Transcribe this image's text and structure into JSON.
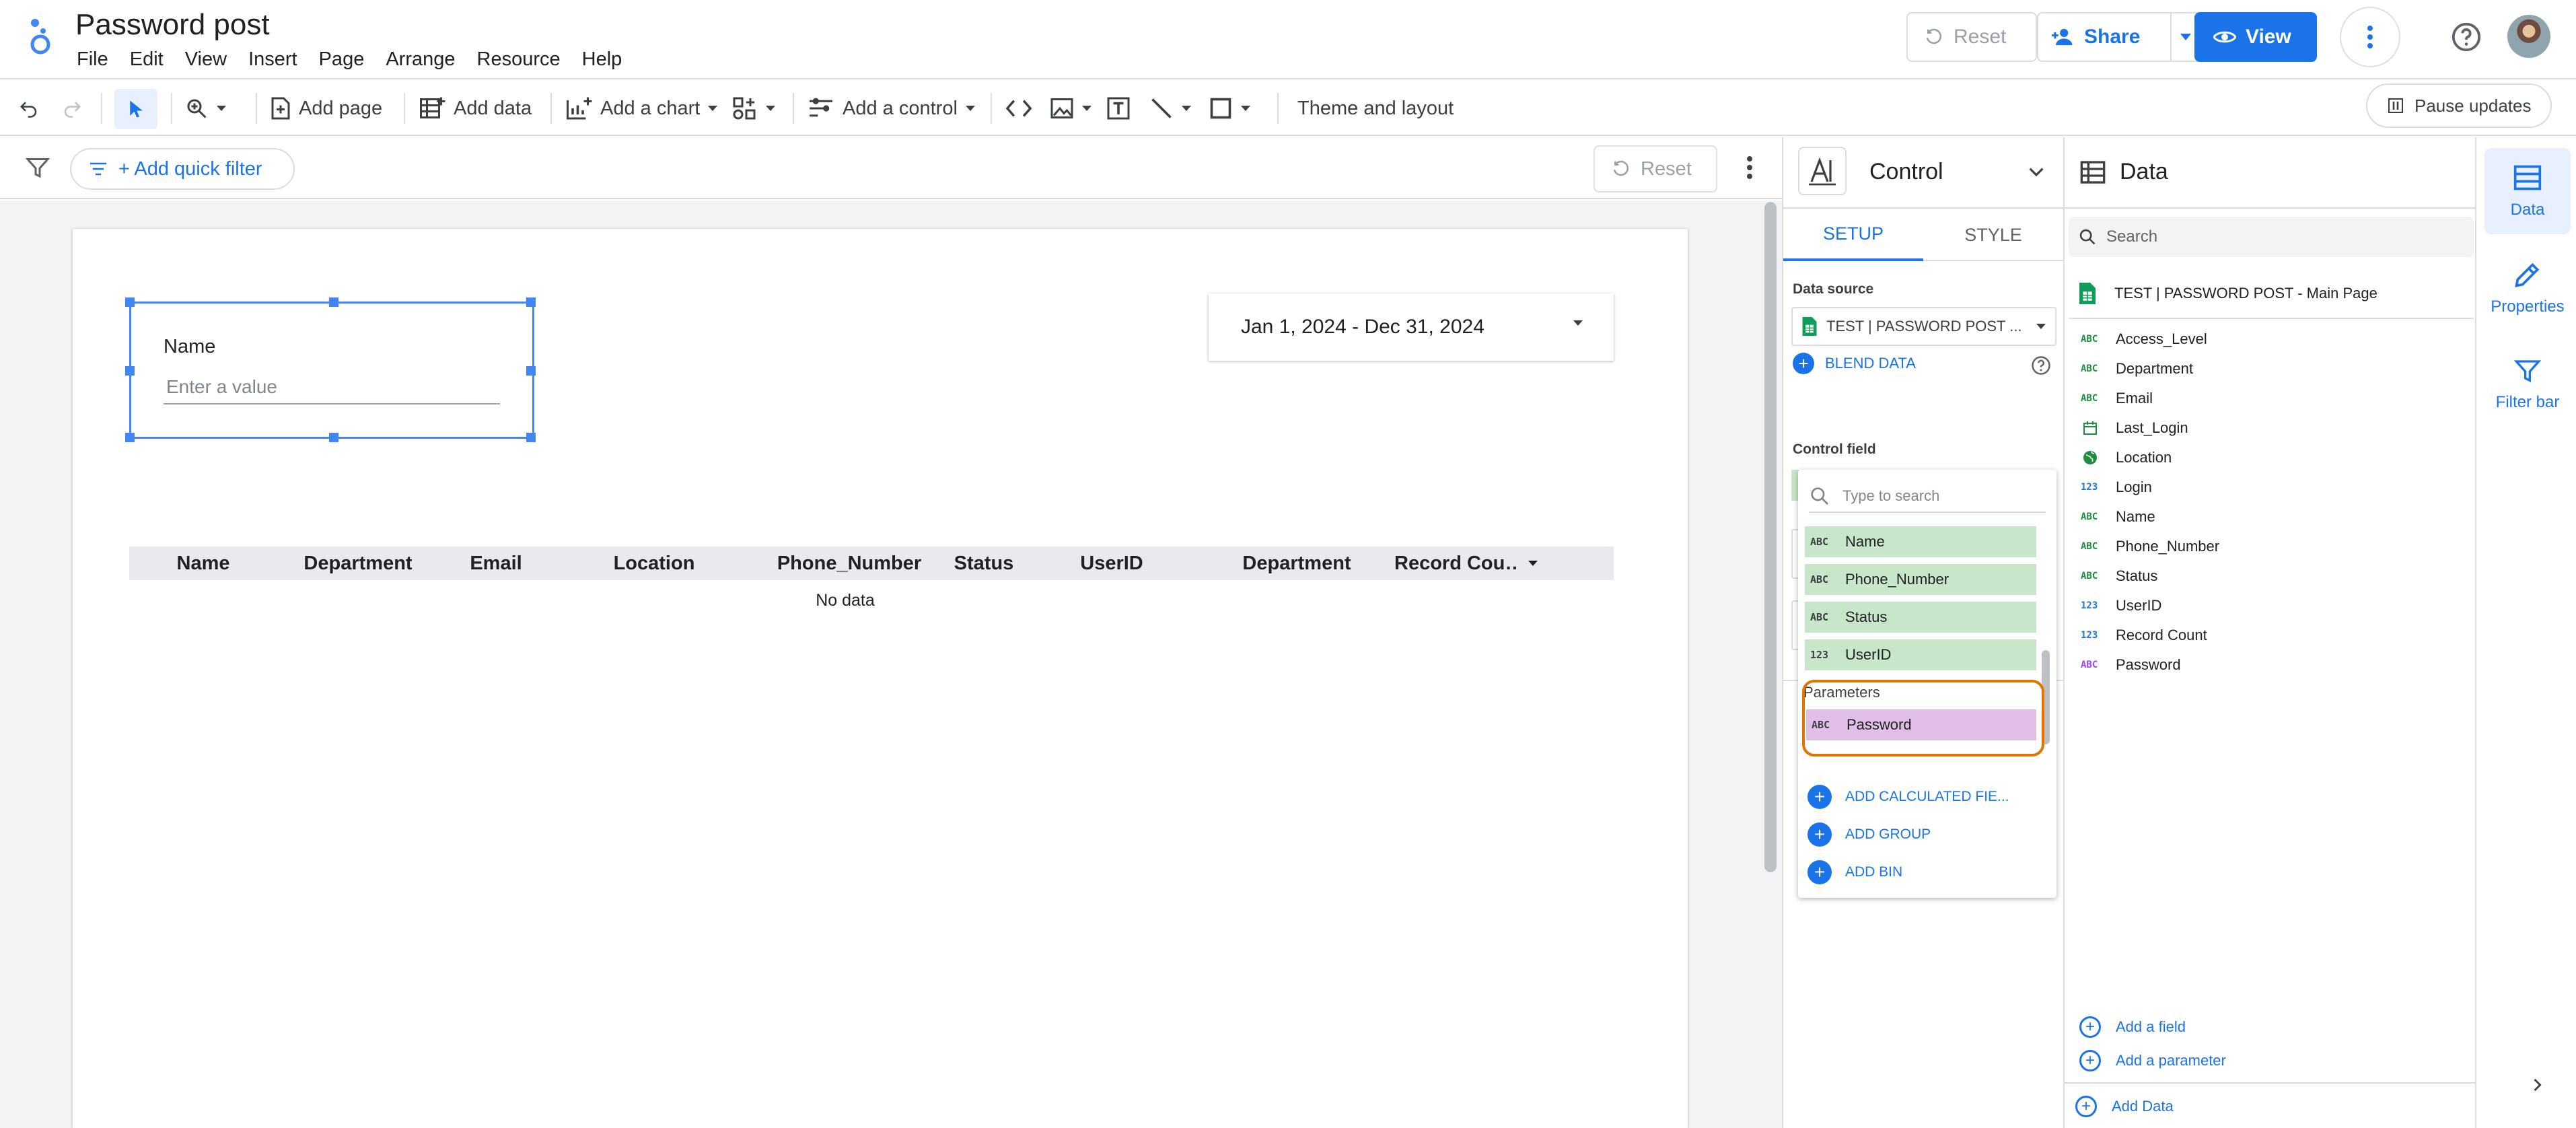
{
  "header": {
    "title": "Password post",
    "menus": [
      "File",
      "Edit",
      "View",
      "Insert",
      "Page",
      "Arrange",
      "Resource",
      "Help"
    ],
    "reset_label": "Reset",
    "share_label": "Share",
    "view_label": "View"
  },
  "toolbar": {
    "add_page": "Add page",
    "add_data": "Add data",
    "add_chart": "Add a chart",
    "add_control": "Add a control",
    "theme": "Theme and layout",
    "pause": "Pause updates"
  },
  "filter_bar": {
    "quick_filter": "+ Add quick filter",
    "reset_label": "Reset"
  },
  "canvas": {
    "name_control": {
      "label": "Name",
      "placeholder": "Enter a value"
    },
    "date_range": "Jan 1, 2024 - Dec 31, 2024",
    "table": {
      "columns": [
        "Name",
        "Department",
        "Email",
        "Location",
        "Phone_Number",
        "Status",
        "UserID",
        "Department",
        "Record Cou…"
      ],
      "empty_text": "No data"
    }
  },
  "properties": {
    "title": "Control",
    "tabs": [
      "SETUP",
      "STYLE"
    ],
    "data_source_label": "Data source",
    "data_source_value": "TEST | PASSWORD POST ...",
    "blend_label": "BLEND DATA",
    "control_field_label": "Control field"
  },
  "field_dropdown": {
    "search_placeholder": "Type to search",
    "fields": [
      {
        "type": "ABC",
        "name": "Name"
      },
      {
        "type": "ABC",
        "name": "Phone_Number"
      },
      {
        "type": "ABC",
        "name": "Status"
      },
      {
        "type": "123",
        "name": "UserID"
      }
    ],
    "parameters_label": "Parameters",
    "parameters": [
      {
        "type": "ABC",
        "name": "Password"
      }
    ],
    "actions": [
      "ADD CALCULATED FIE...",
      "ADD GROUP",
      "ADD BIN"
    ]
  },
  "data_panel": {
    "title": "Data",
    "search_placeholder": "Search",
    "source_name": "TEST | PASSWORD POST - Main Page",
    "fields": [
      {
        "type": "ABC",
        "name": "Access_Level",
        "icon": "text"
      },
      {
        "type": "ABC",
        "name": "Department",
        "icon": "text"
      },
      {
        "type": "ABC",
        "name": "Email",
        "icon": "text"
      },
      {
        "type": "DATE",
        "name": "Last_Login",
        "icon": "calendar"
      },
      {
        "type": "GEO",
        "name": "Location",
        "icon": "globe"
      },
      {
        "type": "123",
        "name": "Login",
        "icon": "number"
      },
      {
        "type": "ABC",
        "name": "Name",
        "icon": "text"
      },
      {
        "type": "ABC",
        "name": "Phone_Number",
        "icon": "text"
      },
      {
        "type": "ABC",
        "name": "Status",
        "icon": "text"
      },
      {
        "type": "123",
        "name": "UserID",
        "icon": "number"
      },
      {
        "type": "123",
        "name": "Record Count",
        "icon": "number"
      },
      {
        "type": "ABC",
        "name": "Password",
        "icon": "parameter"
      }
    ],
    "add_field": "Add a field",
    "add_parameter": "Add a parameter",
    "add_data": "Add Data"
  },
  "rail": {
    "items": [
      "Data",
      "Properties",
      "Filter bar"
    ]
  },
  "colors": {
    "accent": "#1a73e8",
    "dimension_chip": "#c8e6c9",
    "parameter_chip": "#e1bee7",
    "highlight": "#e37400"
  }
}
